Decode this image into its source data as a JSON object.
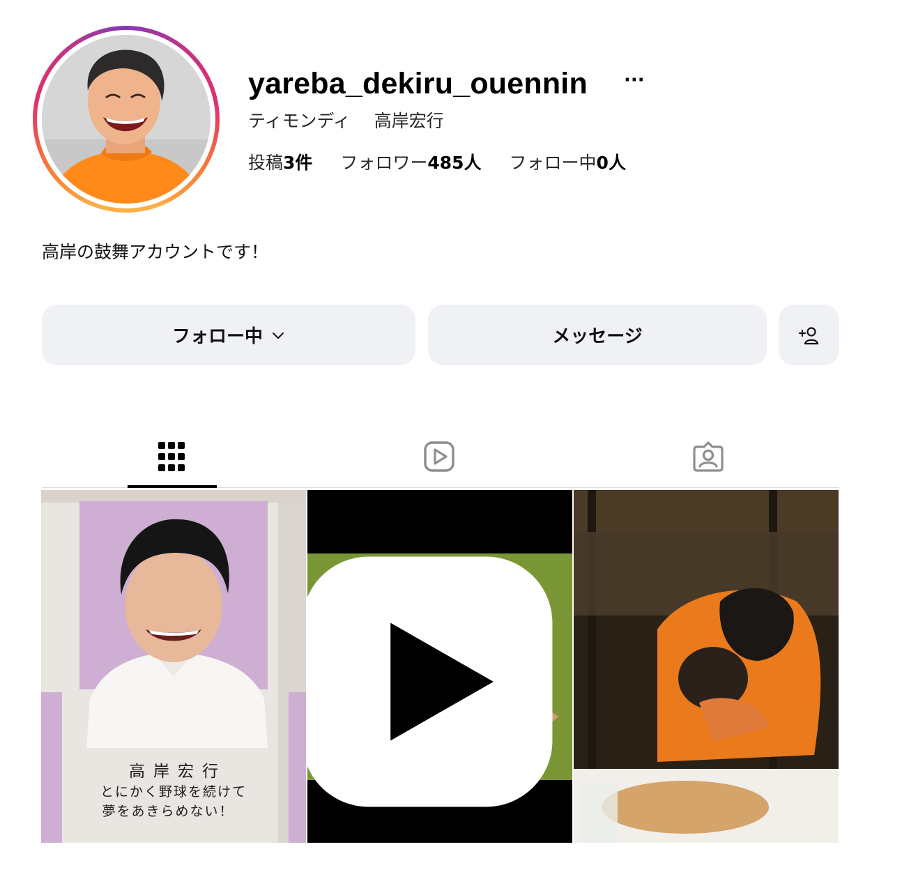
{
  "profile": {
    "username": "yareba_dekiru_ouennin",
    "more_label": "···",
    "fullname_group": "ティモンディ",
    "fullname_person": "高岸宏行",
    "stats": {
      "posts_label": "投稿",
      "posts_value": "3件",
      "followers_label": "フォロワー",
      "followers_value": "485人",
      "following_label": "フォロー中",
      "following_value": "0人"
    },
    "bio": "高岸の鼓舞アカウントです！",
    "avatar_icon": "profile-photo"
  },
  "actions": {
    "follow_label": "フォロー中",
    "message_label": "メッセージ",
    "add_user_icon": "add-person-icon"
  },
  "tabs": [
    {
      "name": "posts",
      "icon": "grid-icon",
      "active": true
    },
    {
      "name": "reels",
      "icon": "reels-icon",
      "active": false
    },
    {
      "name": "tagged",
      "icon": "tagged-user-icon",
      "active": false
    }
  ],
  "posts": [
    {
      "type": "image",
      "caption_name": "高岸宏行",
      "caption_line1": "とにかく野球を続けて",
      "caption_line2": "夢をあきらめない！"
    },
    {
      "type": "reel",
      "badge_icon": "reel-play-icon"
    },
    {
      "type": "image"
    }
  ],
  "colors": {
    "button_bg": "#eff1f5",
    "ring_gradient": [
      "#fcaf45",
      "#f77737",
      "#e1306c",
      "#c13584",
      "#833ab4"
    ],
    "active_tab": "#000000",
    "inactive_tab": "#8e8e8e"
  }
}
